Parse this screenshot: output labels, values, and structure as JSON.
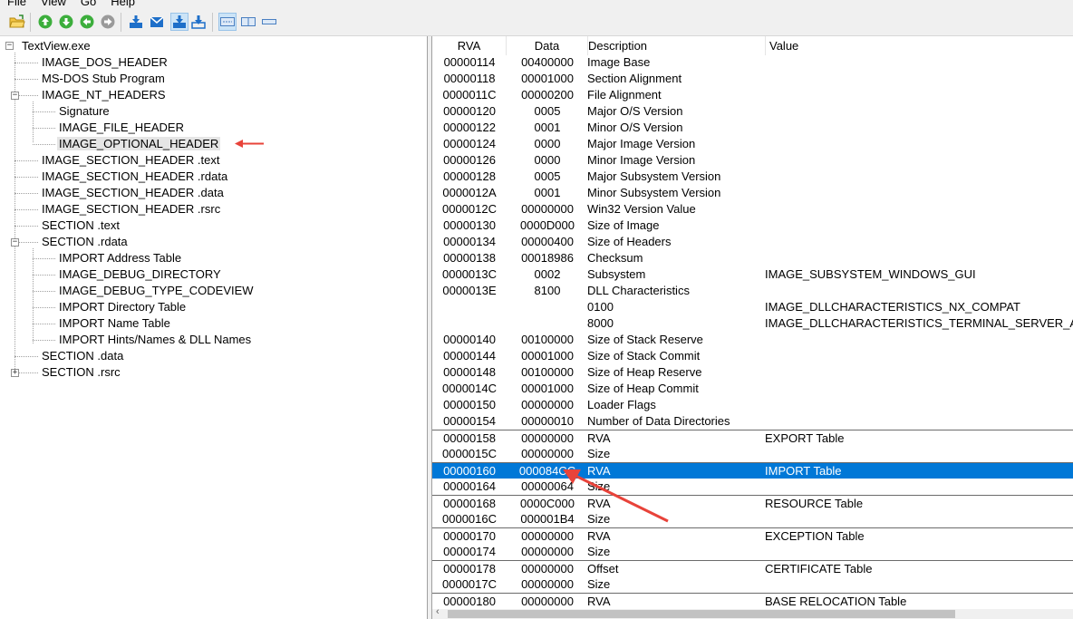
{
  "menu": [
    "File",
    "View",
    "Go",
    "Help"
  ],
  "toolbar": {
    "buttons": [
      {
        "name": "open-file-button",
        "icon": "open-folder-icon",
        "pressed": false
      },
      {
        "name": "go-up-button",
        "icon": "green-up-arrow-icon",
        "pressed": false
      },
      {
        "name": "go-down-button",
        "icon": "green-down-arrow-icon",
        "pressed": false
      },
      {
        "name": "go-back-button",
        "icon": "green-back-arrow-icon",
        "pressed": false
      },
      {
        "name": "go-forward-button",
        "icon": "grey-forward-arrow-icon",
        "pressed": false
      },
      {
        "name": "save-button",
        "icon": "download-icon",
        "pressed": false
      },
      {
        "name": "mail-button",
        "icon": "envelope-icon",
        "pressed": false
      },
      {
        "name": "download-selected-button",
        "icon": "download-icon",
        "pressed": true
      },
      {
        "name": "download-all-button",
        "icon": "download-icon",
        "pressed": false
      },
      {
        "name": "view-mode-1-button",
        "icon": "view-list-icon",
        "pressed": true
      },
      {
        "name": "view-mode-2-button",
        "icon": "view-detail-icon",
        "pressed": false
      },
      {
        "name": "view-mode-3-button",
        "icon": "view-bar-icon",
        "pressed": false
      }
    ]
  },
  "tree": {
    "root": "TextView.exe",
    "nodes": [
      {
        "label": "IMAGE_DOS_HEADER",
        "depth": 1
      },
      {
        "label": "MS-DOS Stub Program",
        "depth": 1
      },
      {
        "label": "IMAGE_NT_HEADERS",
        "depth": 1,
        "expander": "-"
      },
      {
        "label": "Signature",
        "depth": 2
      },
      {
        "label": "IMAGE_FILE_HEADER",
        "depth": 2
      },
      {
        "label": "IMAGE_OPTIONAL_HEADER",
        "depth": 2,
        "selected": true
      },
      {
        "label": "IMAGE_SECTION_HEADER .text",
        "depth": 1
      },
      {
        "label": "IMAGE_SECTION_HEADER .rdata",
        "depth": 1
      },
      {
        "label": "IMAGE_SECTION_HEADER .data",
        "depth": 1
      },
      {
        "label": "IMAGE_SECTION_HEADER .rsrc",
        "depth": 1
      },
      {
        "label": "SECTION .text",
        "depth": 1
      },
      {
        "label": "SECTION .rdata",
        "depth": 1,
        "expander": "-"
      },
      {
        "label": "IMPORT Address Table",
        "depth": 2
      },
      {
        "label": "IMAGE_DEBUG_DIRECTORY",
        "depth": 2
      },
      {
        "label": "IMAGE_DEBUG_TYPE_CODEVIEW",
        "depth": 2
      },
      {
        "label": "IMPORT Directory Table",
        "depth": 2
      },
      {
        "label": "IMPORT Name Table",
        "depth": 2
      },
      {
        "label": "IMPORT Hints/Names & DLL Names",
        "depth": 2
      },
      {
        "label": "SECTION .data",
        "depth": 1
      },
      {
        "label": "SECTION .rsrc",
        "depth": 1,
        "expander": "+"
      }
    ]
  },
  "list": {
    "columns": [
      "RVA",
      "Data",
      "Description",
      "Value"
    ],
    "rows": [
      {
        "rva": "00000114",
        "data": "00400000",
        "desc": "Image Base",
        "value": ""
      },
      {
        "rva": "00000118",
        "data": "00001000",
        "desc": "Section Alignment",
        "value": ""
      },
      {
        "rva": "0000011C",
        "data": "00000200",
        "desc": "File Alignment",
        "value": ""
      },
      {
        "rva": "00000120",
        "data": "0005",
        "desc": "Major O/S Version",
        "value": ""
      },
      {
        "rva": "00000122",
        "data": "0001",
        "desc": "Minor O/S Version",
        "value": ""
      },
      {
        "rva": "00000124",
        "data": "0000",
        "desc": "Major Image Version",
        "value": ""
      },
      {
        "rva": "00000126",
        "data": "0000",
        "desc": "Minor Image Version",
        "value": ""
      },
      {
        "rva": "00000128",
        "data": "0005",
        "desc": "Major Subsystem Version",
        "value": ""
      },
      {
        "rva": "0000012A",
        "data": "0001",
        "desc": "Minor Subsystem Version",
        "value": ""
      },
      {
        "rva": "0000012C",
        "data": "00000000",
        "desc": "Win32 Version Value",
        "value": ""
      },
      {
        "rva": "00000130",
        "data": "0000D000",
        "desc": "Size of Image",
        "value": ""
      },
      {
        "rva": "00000134",
        "data": "00000400",
        "desc": "Size of Headers",
        "value": ""
      },
      {
        "rva": "00000138",
        "data": "00018986",
        "desc": "Checksum",
        "value": ""
      },
      {
        "rva": "0000013C",
        "data": "0002",
        "desc": "Subsystem",
        "value": "IMAGE_SUBSYSTEM_WINDOWS_GUI"
      },
      {
        "rva": "0000013E",
        "data": "8100",
        "desc": "DLL Characteristics",
        "value": ""
      },
      {
        "rva": "",
        "data": "",
        "desc": "0100",
        "value": "IMAGE_DLLCHARACTERISTICS_NX_COMPAT"
      },
      {
        "rva": "",
        "data": "",
        "desc": "8000",
        "value": "IMAGE_DLLCHARACTERISTICS_TERMINAL_SERVER_AWARE"
      },
      {
        "rva": "00000140",
        "data": "00100000",
        "desc": "Size of Stack Reserve",
        "value": ""
      },
      {
        "rva": "00000144",
        "data": "00001000",
        "desc": "Size of Stack Commit",
        "value": ""
      },
      {
        "rva": "00000148",
        "data": "00100000",
        "desc": "Size of Heap Reserve",
        "value": ""
      },
      {
        "rva": "0000014C",
        "data": "00001000",
        "desc": "Size of Heap Commit",
        "value": ""
      },
      {
        "rva": "00000150",
        "data": "00000000",
        "desc": "Loader Flags",
        "value": ""
      },
      {
        "rva": "00000154",
        "data": "00000010",
        "desc": "Number of Data Directories",
        "value": ""
      },
      {
        "rva": "00000158",
        "data": "00000000",
        "desc": "RVA",
        "value": "EXPORT Table",
        "group": true
      },
      {
        "rva": "0000015C",
        "data": "00000000",
        "desc": "Size",
        "value": ""
      },
      {
        "rva": "00000160",
        "data": "000084CC",
        "desc": "RVA",
        "value": "IMPORT Table",
        "group": true,
        "selected": true
      },
      {
        "rva": "00000164",
        "data": "00000064",
        "desc": "Size",
        "value": ""
      },
      {
        "rva": "00000168",
        "data": "0000C000",
        "desc": "RVA",
        "value": "RESOURCE Table",
        "group": true
      },
      {
        "rva": "0000016C",
        "data": "000001B4",
        "desc": "Size",
        "value": ""
      },
      {
        "rva": "00000170",
        "data": "00000000",
        "desc": "RVA",
        "value": "EXCEPTION Table",
        "group": true
      },
      {
        "rva": "00000174",
        "data": "00000000",
        "desc": "Size",
        "value": ""
      },
      {
        "rva": "00000178",
        "data": "00000000",
        "desc": "Offset",
        "value": "CERTIFICATE Table",
        "group": true
      },
      {
        "rva": "0000017C",
        "data": "00000000",
        "desc": "Size",
        "value": ""
      },
      {
        "rva": "00000180",
        "data": "00000000",
        "desc": "RVA",
        "value": "BASE RELOCATION Table",
        "group": true
      }
    ]
  },
  "colors": {
    "selection": "#0078d7",
    "annotation_arrow": "#e8433a",
    "toolbar_green": "#3cae3c"
  }
}
